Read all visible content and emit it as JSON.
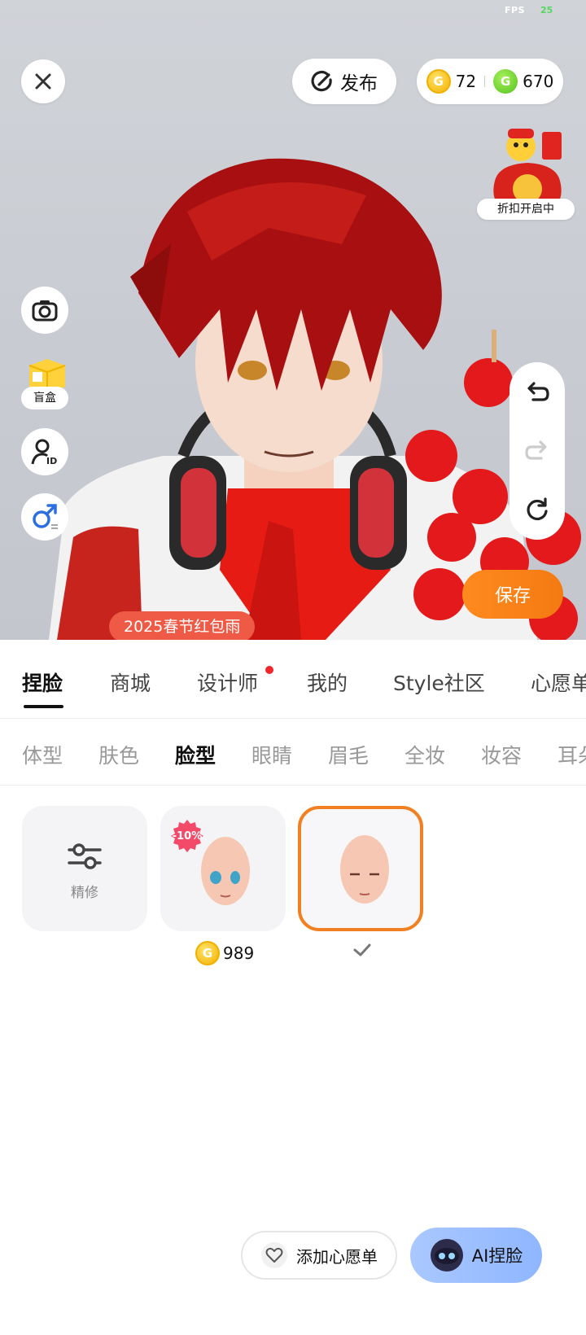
{
  "status": {
    "fps_label": "FPS",
    "fps_value": "25"
  },
  "header": {
    "publish_label": "发布",
    "gold_coins": "72",
    "green_coins": "670"
  },
  "promo": {
    "label": "折扣开启中"
  },
  "side_tools": {
    "blind_box_label": "盲盒"
  },
  "stage": {
    "save_label": "保存",
    "event_tag": "2025春节红包雨"
  },
  "main_tabs": [
    {
      "label": "捏脸",
      "active": true
    },
    {
      "label": "商城"
    },
    {
      "label": "设计师",
      "has_dot": true
    },
    {
      "label": "我的"
    },
    {
      "label": "Style社区"
    },
    {
      "label": "心愿单"
    }
  ],
  "sub_tabs": [
    {
      "label": "体型"
    },
    {
      "label": "肤色"
    },
    {
      "label": "脸型",
      "active": true
    },
    {
      "label": "眼睛"
    },
    {
      "label": "眉毛"
    },
    {
      "label": "全妆"
    },
    {
      "label": "妆容"
    },
    {
      "label": "耳朵"
    }
  ],
  "items": {
    "refine_label": "精修",
    "discount": "-10%",
    "price": "989"
  },
  "bottom": {
    "wishlist_label": "添加心愿单",
    "ai_label": "AI捏脸"
  },
  "colors": {
    "accent_orange": "#f08021",
    "event_red": "#ee5a45",
    "ai_blue": "#8fb6ff"
  }
}
